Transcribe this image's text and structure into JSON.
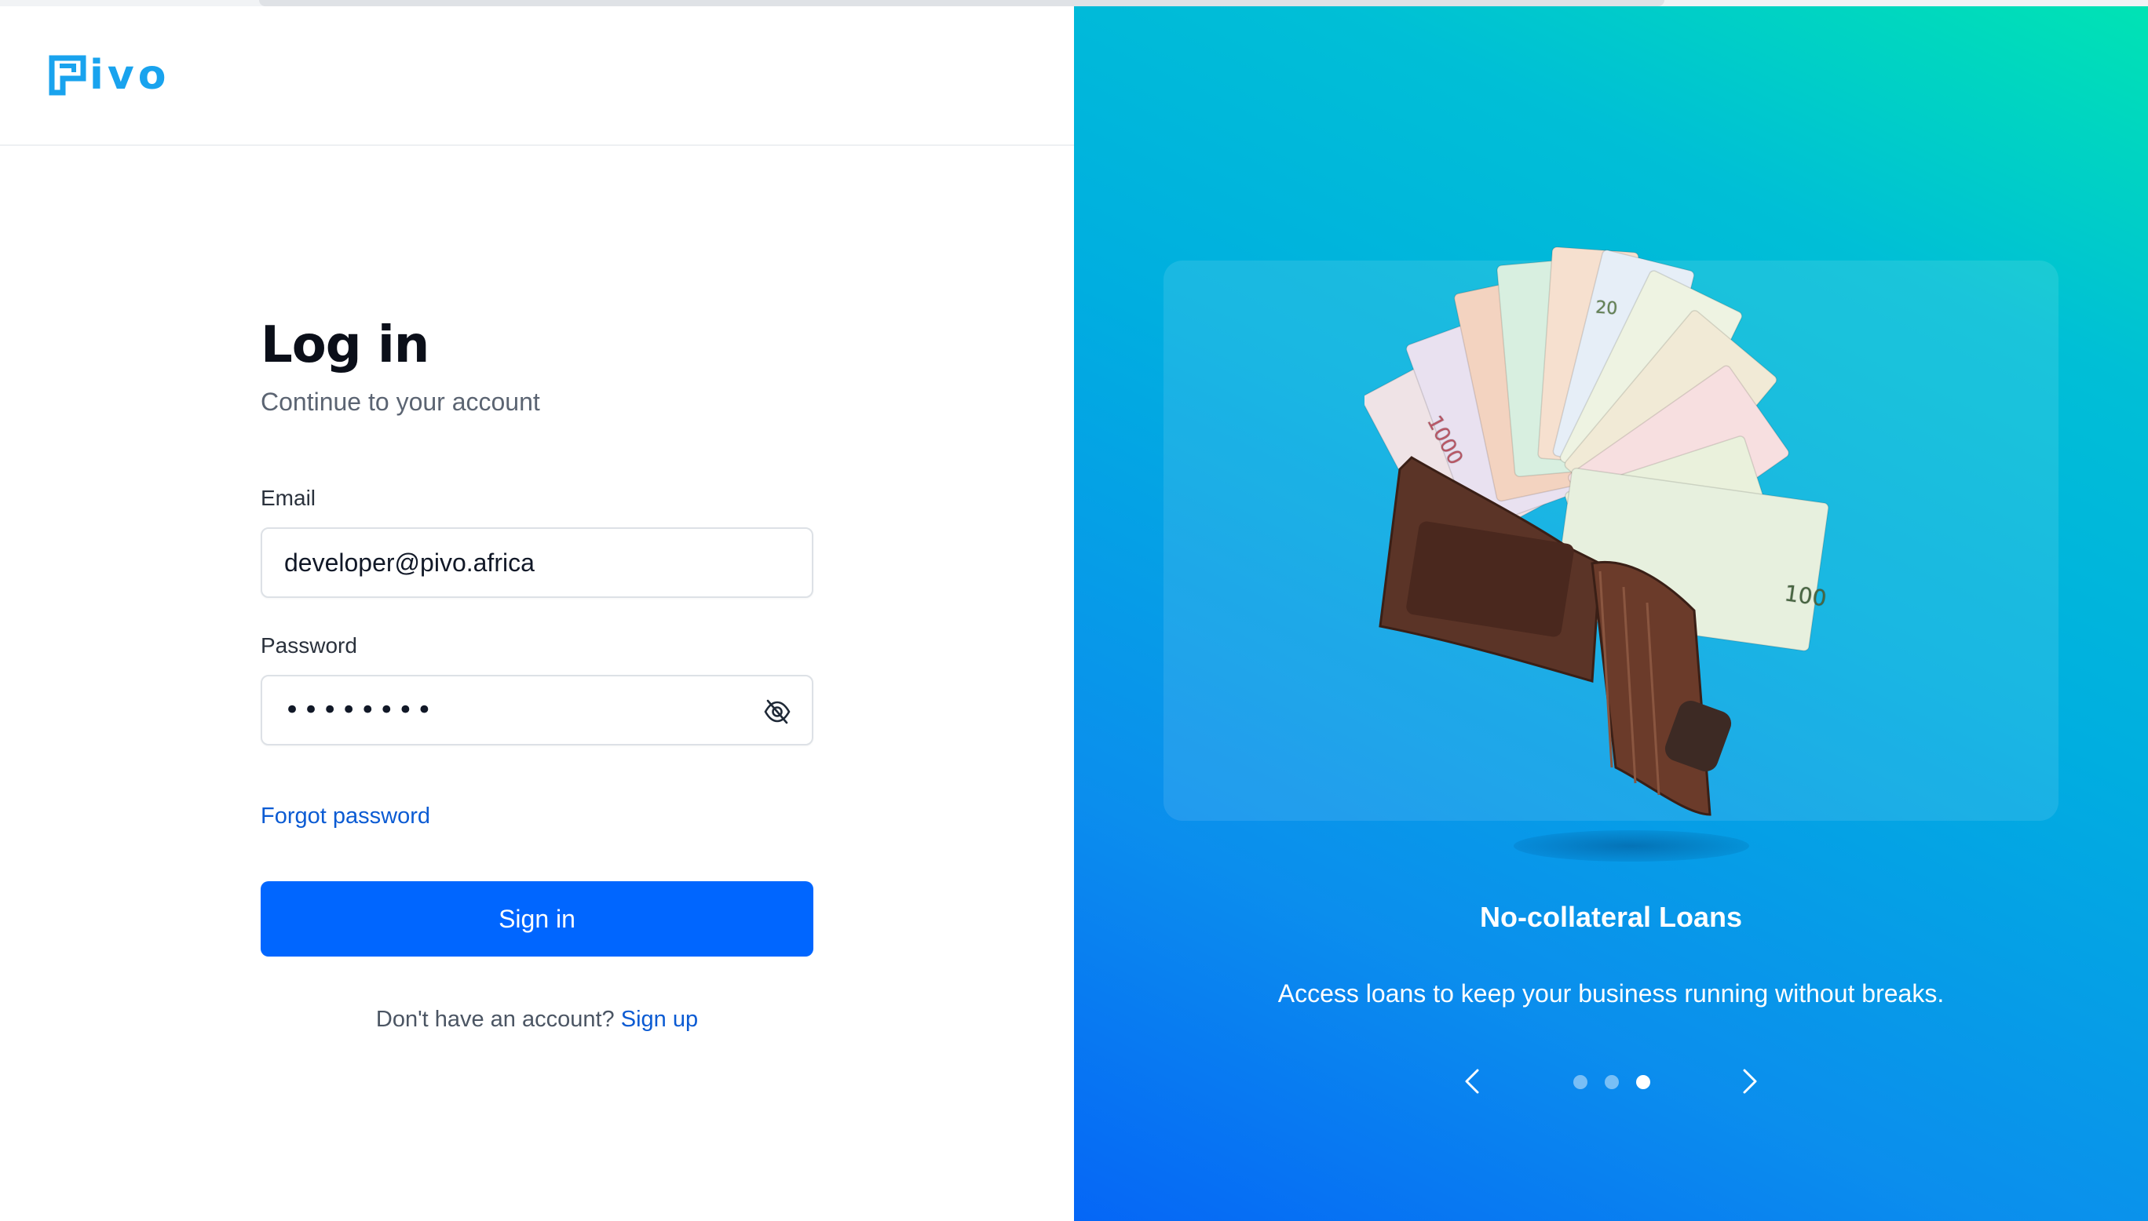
{
  "brand": {
    "name": "Pivo",
    "logo_text": "ivo",
    "color": "#19a3ee"
  },
  "login": {
    "title": "Log in",
    "subtitle": "Continue to your account",
    "email_label": "Email",
    "email_value": "developer@pivo.africa",
    "password_label": "Password",
    "password_mask": "••••••••",
    "toggle_icon": "eye-off-icon",
    "forgot_label": "Forgot password",
    "signin_label": "Sign in",
    "signup_prompt": "Don't have an account?",
    "signup_label": "Sign up",
    "accent_color": "#0066ff"
  },
  "promo": {
    "illustration": "wallet-with-banknotes",
    "title": "No-collateral Loans",
    "description": "Access loans to keep your business running without breaks.",
    "slide_count": 3,
    "active_slide": 3,
    "prev_icon": "chevron-left-icon",
    "next_icon": "chevron-right-icon"
  }
}
